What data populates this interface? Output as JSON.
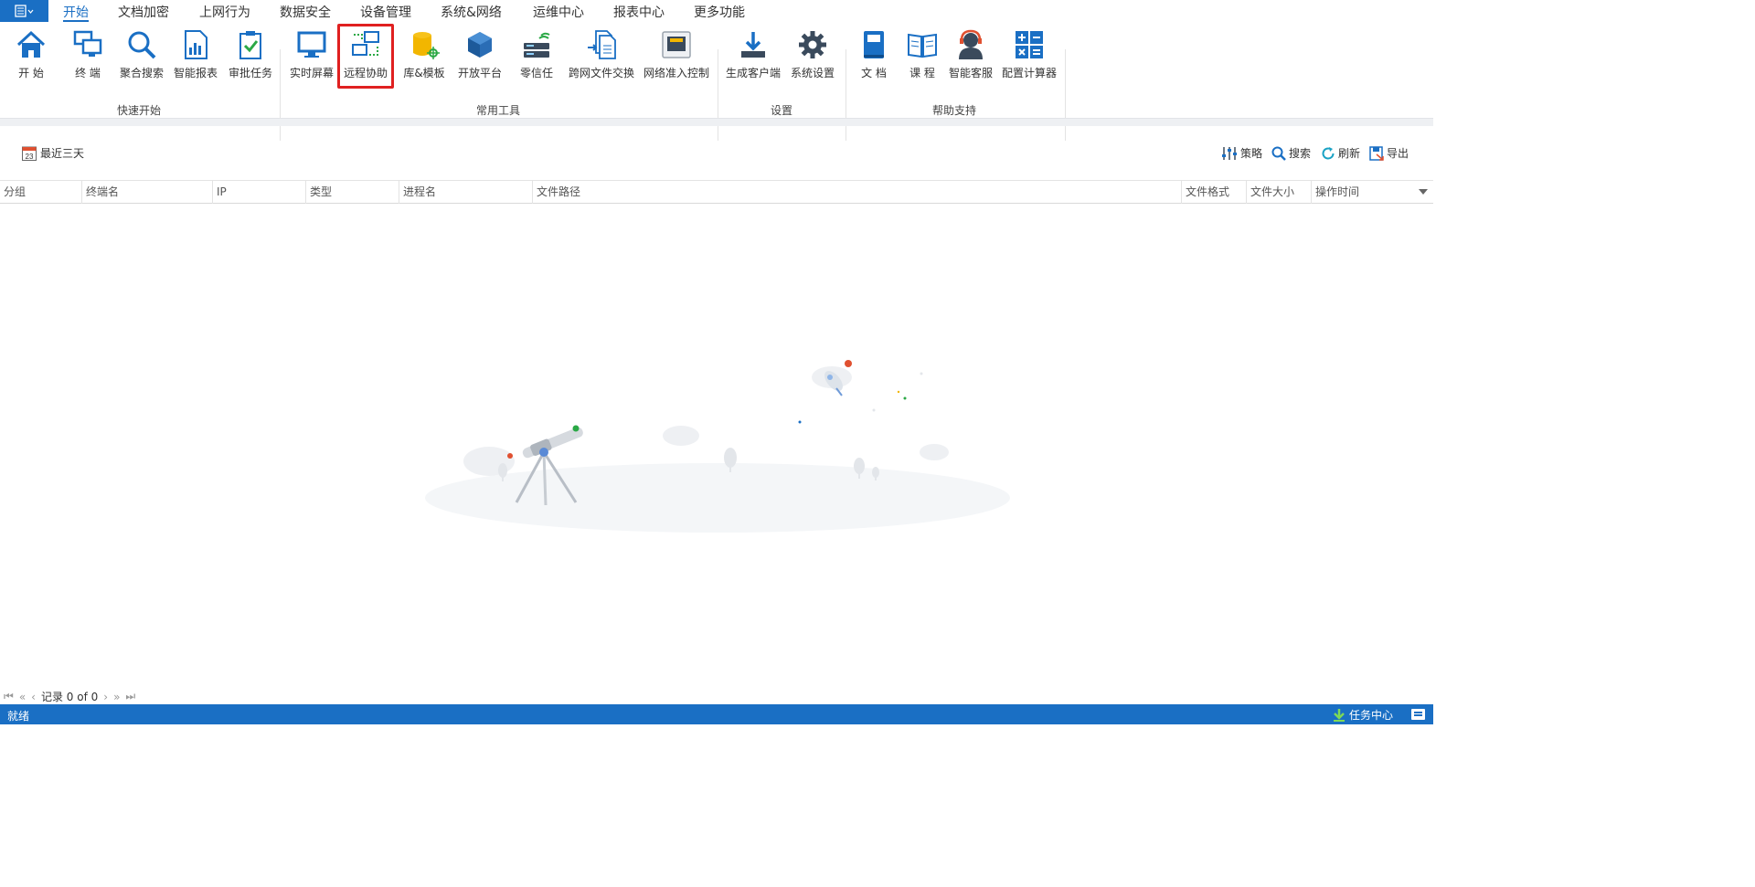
{
  "menubar": {
    "app_icon": "menu-list-icon",
    "items": [
      {
        "label": "开始",
        "active": true
      },
      {
        "label": "文档加密"
      },
      {
        "label": "上网行为"
      },
      {
        "label": "数据安全"
      },
      {
        "label": "设备管理"
      },
      {
        "label": "系统&网络"
      },
      {
        "label": "运维中心"
      },
      {
        "label": "报表中心"
      },
      {
        "label": "更多功能"
      }
    ]
  },
  "ribbon": {
    "groups": [
      {
        "label": "快速开始",
        "tools": [
          {
            "label": "开 始",
            "icon": "home-icon"
          },
          {
            "label": "终 端",
            "icon": "terminal-computers-icon"
          },
          {
            "label": "聚合搜索",
            "icon": "search-icon"
          },
          {
            "label": "智能报表",
            "icon": "report-icon"
          },
          {
            "label": "审批任务",
            "icon": "approval-icon"
          }
        ]
      },
      {
        "label": "常用工具",
        "tools": [
          {
            "label": "实时屏幕",
            "icon": "monitor-icon"
          },
          {
            "label": "远程协助",
            "icon": "remote-assist-icon",
            "highlighted": true
          },
          {
            "label": "库&模板",
            "icon": "database-template-icon"
          },
          {
            "label": "开放平台",
            "icon": "open-platform-icon"
          },
          {
            "label": "零信任",
            "icon": "zero-trust-icon"
          },
          {
            "label": "跨网文件交换",
            "icon": "file-exchange-icon"
          },
          {
            "label": "网络准入控制",
            "icon": "network-access-icon"
          }
        ]
      },
      {
        "label": "设置",
        "tools": [
          {
            "label": "生成客户端",
            "icon": "download-client-icon"
          },
          {
            "label": "系统设置",
            "icon": "gear-icon"
          }
        ]
      },
      {
        "label": "帮助支持",
        "tools": [
          {
            "label": "文 档",
            "icon": "book-icon"
          },
          {
            "label": "课 程",
            "icon": "open-book-icon"
          },
          {
            "label": "智能客服",
            "icon": "support-agent-icon"
          },
          {
            "label": "配置计算器",
            "icon": "calculator-icon"
          }
        ]
      }
    ]
  },
  "filter": {
    "date_label": "最近三天",
    "date_icon_text": "23"
  },
  "actions": {
    "strategy": "策略",
    "search": "搜索",
    "refresh": "刷新",
    "export": "导出"
  },
  "table": {
    "columns": [
      "分组",
      "终端名",
      "IP",
      "类型",
      "进程名",
      "文件路径",
      "文件格式",
      "文件大小",
      "操作时间"
    ],
    "rows": []
  },
  "pager": {
    "record_text": "记录 0 of 0"
  },
  "status": {
    "text": "就绪",
    "task_center": "任务中心"
  },
  "colors": {
    "accent": "#1a6fc4",
    "highlight": "#e02020"
  }
}
